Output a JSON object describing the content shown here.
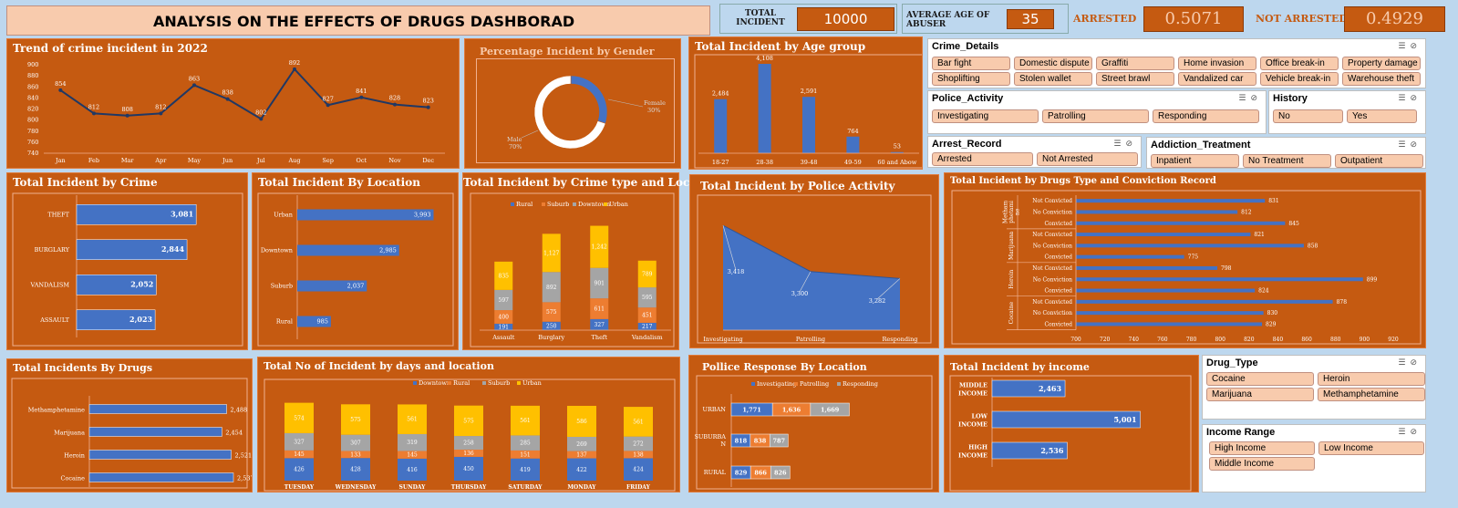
{
  "header": {
    "title": "ANALYSIS ON THE EFFECTS OF DRUGS DASHBORAD"
  },
  "kpis": {
    "total_incident_label": "TOTAL INCIDENT",
    "total_incident_value": "10000",
    "avg_age_label": "AVERAGE AGE OF ABUSER",
    "avg_age_value": "35",
    "arrested_label": "ARRESTED",
    "arrested_value": "0.5071",
    "not_arrested_label": "NOT ARRESTED",
    "not_arrested_value": "0.4929"
  },
  "colors": {
    "panel": "#c55a11",
    "blue": "#4472c4",
    "orange": "#ed7d31",
    "gray": "#a5a5a5",
    "yellow": "#ffc000",
    "chip": "#f8cbad",
    "bg": "#bdd7ee"
  },
  "chart_data": [
    {
      "id": "trend",
      "type": "line",
      "title": "Trend of crime incident in 2022",
      "categories": [
        "Jan",
        "Feb",
        "Mar",
        "Apr",
        "May",
        "Jun",
        "Jul",
        "Aug",
        "Sep",
        "Oct",
        "Nov",
        "Dec"
      ],
      "values": [
        854,
        812,
        808,
        812,
        863,
        838,
        802,
        892,
        827,
        841,
        828,
        823
      ],
      "ylim": [
        740,
        900
      ],
      "yticks": [
        740,
        760,
        780,
        800,
        820,
        840,
        860,
        880,
        900
      ]
    },
    {
      "id": "gender",
      "type": "pie",
      "title": "Percentage Incident by Gender",
      "labels": [
        "Female",
        "Male"
      ],
      "values": [
        30,
        70
      ],
      "value_labels": [
        "30%",
        "70%"
      ]
    },
    {
      "id": "age",
      "type": "bar",
      "title": "Total Incident by Age group",
      "categories": [
        "18-27",
        "28-38",
        "39-48",
        "49-59",
        "60 and Abow"
      ],
      "values": [
        2484,
        4108,
        2591,
        764,
        53
      ],
      "value_labels": [
        "2,484",
        "4,108",
        "2,591",
        "764",
        "53"
      ]
    },
    {
      "id": "crime",
      "type": "bar",
      "title": "Total Incident by Crime",
      "categories": [
        "THEFT",
        "BURGLARY",
        "VANDALISM",
        "ASSAULT"
      ],
      "values": [
        3081,
        2844,
        2052,
        2023
      ],
      "value_labels": [
        "3,081",
        "2,844",
        "2,052",
        "2,023"
      ]
    },
    {
      "id": "location",
      "type": "bar",
      "title": "Total Incident By Location",
      "categories": [
        "Urban",
        "Downtown",
        "Suburb",
        "Rural"
      ],
      "values": [
        3993,
        2985,
        2037,
        985
      ],
      "value_labels": [
        "3,993",
        "2,985",
        "2,037",
        "985"
      ]
    },
    {
      "id": "crime_loc",
      "type": "bar",
      "title": "Total Incident by Crime type and Location",
      "categories": [
        "Assault",
        "Burglary",
        "Theft",
        "Vandalism"
      ],
      "series": [
        {
          "name": "Rural",
          "values": [
            191,
            250,
            327,
            217
          ],
          "labels": [
            "191",
            "250",
            "327",
            "217"
          ]
        },
        {
          "name": "Suburb",
          "values": [
            400,
            575,
            611,
            451
          ],
          "labels": [
            "400",
            "575",
            "611",
            "451"
          ]
        },
        {
          "name": "Downtown",
          "values": [
            597,
            892,
            901,
            595
          ],
          "labels": [
            "597",
            "892",
            "901",
            "595"
          ]
        },
        {
          "name": "Urban",
          "values": [
            835,
            1127,
            1242,
            789
          ],
          "labels": [
            "835",
            "1,127",
            "1,242",
            "789"
          ]
        }
      ]
    },
    {
      "id": "police",
      "type": "area",
      "title": "Total Incident by Police Activity",
      "categories": [
        "Investigating",
        "Patrolling",
        "Responding"
      ],
      "values": [
        3418,
        3300,
        3282
      ],
      "value_labels": [
        "3,418",
        "3,300",
        "3,282"
      ]
    },
    {
      "id": "drugs_conv",
      "type": "bar",
      "title": "Total Incident by Drugs Type and Conviction Record",
      "groups": [
        {
          "name": "Methamphetamine",
          "label_lines": [
            "Metham",
            "phetami",
            "ne"
          ],
          "rows": [
            {
              "label": "Not Convicted",
              "value": 831
            },
            {
              "label": "No Conviction",
              "value": 812
            },
            {
              "label": "Convicted",
              "value": 845
            }
          ]
        },
        {
          "name": "Marijuana",
          "label_lines": [
            "Marijuana"
          ],
          "rows": [
            {
              "label": "Not Convicted",
              "value": 821
            },
            {
              "label": "No Conviction",
              "value": 858
            },
            {
              "label": "Convicted",
              "value": 775
            }
          ]
        },
        {
          "name": "Heroin",
          "label_lines": [
            "Heroin"
          ],
          "rows": [
            {
              "label": "Not Convicted",
              "value": 798
            },
            {
              "label": "No Conviction",
              "value": 899
            },
            {
              "label": "Convicted",
              "value": 824
            }
          ]
        },
        {
          "name": "Cocaine",
          "label_lines": [
            "Cocaine"
          ],
          "rows": [
            {
              "label": "Not Convicted",
              "value": 878
            },
            {
              "label": "No Conviction",
              "value": 830
            },
            {
              "label": "Convicted",
              "value": 829
            }
          ]
        }
      ],
      "xlim": [
        700,
        920
      ],
      "xticks": [
        700,
        720,
        740,
        760,
        780,
        800,
        820,
        840,
        860,
        880,
        900,
        920
      ]
    },
    {
      "id": "drugs",
      "type": "bar",
      "title": "Total Incidents By Drugs",
      "categories": [
        "Methamphetamine",
        "Marijuana",
        "Heroin",
        "Cocaine"
      ],
      "values": [
        2488,
        2454,
        2521,
        2537
      ],
      "value_labels": [
        "2,488",
        "2,454",
        "2,521",
        "2,537"
      ]
    },
    {
      "id": "days",
      "type": "bar",
      "title": "Total No of Incident by days and location",
      "categories": [
        "TUESDAY",
        "WEDNESDAY",
        "SUNDAY",
        "THURSDAY",
        "SATURDAY",
        "MONDAY",
        "FRIDAY"
      ],
      "series": [
        {
          "name": "Downtown",
          "values": [
            426,
            428,
            416,
            450,
            419,
            422,
            424
          ],
          "labels": [
            "426",
            "428",
            "416",
            "450",
            "419",
            "422",
            "424"
          ]
        },
        {
          "name": "Rural",
          "values": [
            145,
            133,
            145,
            136,
            151,
            137,
            138
          ],
          "labels": [
            "145",
            "133",
            "145",
            "136",
            "151",
            "137",
            "138"
          ]
        },
        {
          "name": "Suburb",
          "values": [
            327,
            307,
            319,
            258,
            285,
            269,
            272
          ],
          "labels": [
            "327",
            "307",
            "319",
            "258",
            "285",
            "269",
            "272"
          ]
        },
        {
          "name": "Urban",
          "values": [
            574,
            575,
            561,
            575,
            561,
            586,
            561
          ],
          "labels": [
            "574",
            "575",
            "561",
            "575",
            "561",
            "586",
            "561"
          ]
        }
      ]
    },
    {
      "id": "response",
      "type": "bar",
      "title": "Pollice Response By Location",
      "categories": [
        "URBAN",
        "SUBURBAN",
        "RURAL"
      ],
      "category_lines": [
        [
          "URBAN"
        ],
        [
          "SUBURBA",
          "N"
        ],
        [
          "RURAL"
        ]
      ],
      "series": [
        {
          "name": "Investigating",
          "values": [
            1771,
            818,
            829
          ],
          "labels": [
            "1,771",
            "818",
            "829"
          ]
        },
        {
          "name": "Patrolling",
          "values": [
            1636,
            838,
            866
          ],
          "labels": [
            "1,636",
            "838",
            "866"
          ]
        },
        {
          "name": "Responding",
          "values": [
            1669,
            787,
            826
          ],
          "labels": [
            "1,669",
            "787",
            "826"
          ]
        }
      ]
    },
    {
      "id": "income",
      "type": "bar",
      "title": "Total Incident by income",
      "categories": [
        "MIDDLE INCOME",
        "LOW INCOME",
        "HIGH INCOME"
      ],
      "category_lines": [
        [
          "MIDDLE",
          "INCOME"
        ],
        [
          "LOW",
          "INCOME"
        ],
        [
          "HIGH",
          "INCOME"
        ]
      ],
      "values": [
        2463,
        5001,
        2536
      ],
      "value_labels": [
        "2,463",
        "5,001",
        "2,536"
      ]
    }
  ],
  "slicers": {
    "crime_details": {
      "title": "Crime_Details",
      "items": [
        "Bar fight",
        "Domestic dispute",
        "Graffiti",
        "Home invasion",
        "Office break-in",
        "Property damage",
        "Shoplifting",
        "Stolen wallet",
        "Street brawl",
        "Vandalized car",
        "Vehicle break-in",
        "Warehouse theft"
      ]
    },
    "police_activity": {
      "title": "Police_Activity",
      "items": [
        "Investigating",
        "Patrolling",
        "Responding"
      ]
    },
    "history": {
      "title": "History",
      "items": [
        "No",
        "Yes"
      ]
    },
    "arrest_record": {
      "title": "Arrest_Record",
      "items": [
        "Arrested",
        "Not Arrested"
      ]
    },
    "addiction_treatment": {
      "title": "Addiction_Treatment",
      "items": [
        "Inpatient",
        "No Treatment",
        "Outpatient"
      ]
    },
    "drug_type": {
      "title": "Drug_Type",
      "items": [
        "Cocaine",
        "Heroin",
        "Marijuana",
        "Methamphetamine"
      ]
    },
    "income_range": {
      "title": "Income Range",
      "items": [
        "High Income",
        "Low Income",
        "Middle Income"
      ]
    }
  }
}
